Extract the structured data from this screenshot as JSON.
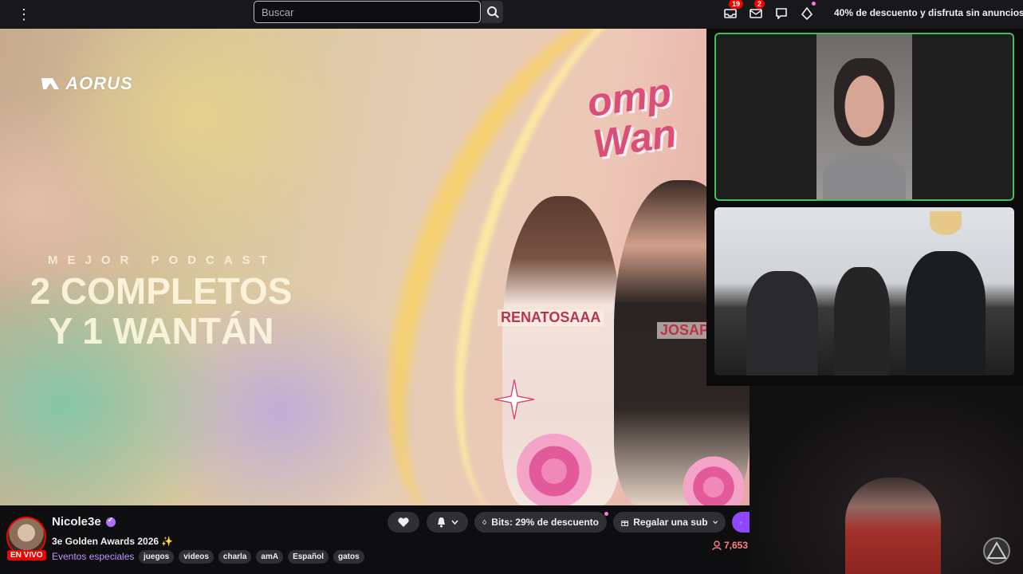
{
  "topbar": {
    "search_placeholder": "Buscar",
    "notifications_count": "19",
    "inbox_count": "2",
    "promo_text": "40% de descuento y disfruta sin anuncios"
  },
  "video": {
    "brand_logo": "AORUS",
    "subtitle": "MEJOR PODCAST",
    "title_line1": "2 COMPLETOS",
    "title_line2": "Y 1 WANTÁN",
    "poster_title_line1": "omp",
    "poster_title_line2": "Wan",
    "name_tag_1": "RENATOSAAA",
    "name_tag_2": "JOSAPP"
  },
  "channel": {
    "name": "Nicole3e",
    "live_label": "EN VIVO",
    "stream_title": "3e Golden Awards 2026 ✨",
    "category": "Eventos especiales",
    "tags": [
      "juegos",
      "videos",
      "charla",
      "amA",
      "Español",
      "gatos"
    ],
    "viewers": "7,653"
  },
  "actions": {
    "bits_label": "Bits: 29% de descuento",
    "gift_label": "Regalar una sub"
  },
  "colors": {
    "accent": "#9147ff",
    "live": "#eb0400",
    "active_speaker_border": "#3fbf5f"
  }
}
